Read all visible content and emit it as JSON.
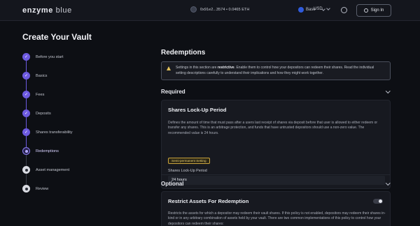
{
  "topbar": {
    "logo_bold": "enzyme",
    "logo_light": "blue",
    "wallet": "0x91e2...3574 • 0.0465 ETH",
    "network": "Base",
    "currency": "USD",
    "signin_label": "Sign In"
  },
  "page_title": "Create Your Vault",
  "steps": [
    {
      "label": "Before you start",
      "state": "done"
    },
    {
      "label": "Basics",
      "state": "done"
    },
    {
      "label": "Fees",
      "state": "done"
    },
    {
      "label": "Deposits",
      "state": "done"
    },
    {
      "label": "Shares transferability",
      "state": "done"
    },
    {
      "label": "Redemptions",
      "state": "current"
    },
    {
      "label": "Asset management",
      "state": "todo"
    },
    {
      "label": "Review",
      "state": "todo"
    }
  ],
  "main": {
    "section_title": "Redemptions",
    "warning_pre": "Settings in this section are ",
    "warning_bold": "restrictive",
    "warning_post": ". Enable them to control how your depositors can redeem their shares. Read the individual setting descriptions carefully to understand their implications and how they might work together.",
    "required_title": "Required",
    "lockup": {
      "title": "Shares Lock-Up Period",
      "description": "Defines the amount of time that must pass after a users last receipt of shares via deposit before that user is allowed to either redeem or transfer any shares. This is an arbitrage protection, and funds that have untrusted depositors should use a non-zero value. The recommended value is 24 hours.",
      "tag": "Semi-permanent Setting",
      "field_label": "Shares Lock-Up Period",
      "field_value": "24 hours"
    },
    "optional_title": "Optional",
    "restrict": {
      "title": "Restrict Assets For Redemption",
      "description": "Restricts the assets for which a depositor may redeem their vault shares. If this policy is not enabled, depositors may redeem their shares in-kind or in any arbitrary combination of assets held by your vault. There are two common implementations of this policy to control how your depositors can redeem their shares:"
    }
  }
}
